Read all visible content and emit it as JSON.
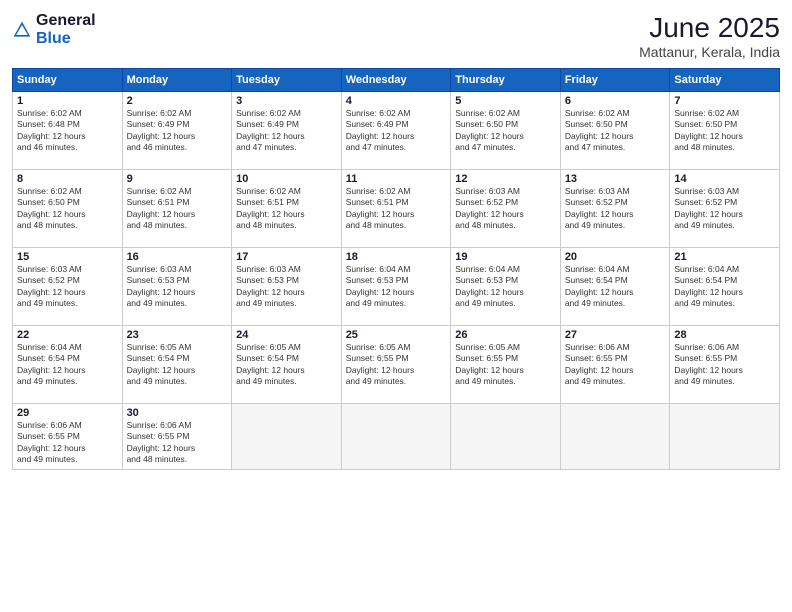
{
  "logo": {
    "general": "General",
    "blue": "Blue"
  },
  "title": "June 2025",
  "location": "Mattanur, Kerala, India",
  "days_header": [
    "Sunday",
    "Monday",
    "Tuesday",
    "Wednesday",
    "Thursday",
    "Friday",
    "Saturday"
  ],
  "weeks": [
    [
      {
        "day": "1",
        "sunrise": "6:02 AM",
        "sunset": "6:48 PM",
        "daylight": "12 hours and 46 minutes."
      },
      {
        "day": "2",
        "sunrise": "6:02 AM",
        "sunset": "6:49 PM",
        "daylight": "12 hours and 46 minutes."
      },
      {
        "day": "3",
        "sunrise": "6:02 AM",
        "sunset": "6:49 PM",
        "daylight": "12 hours and 47 minutes."
      },
      {
        "day": "4",
        "sunrise": "6:02 AM",
        "sunset": "6:49 PM",
        "daylight": "12 hours and 47 minutes."
      },
      {
        "day": "5",
        "sunrise": "6:02 AM",
        "sunset": "6:50 PM",
        "daylight": "12 hours and 47 minutes."
      },
      {
        "day": "6",
        "sunrise": "6:02 AM",
        "sunset": "6:50 PM",
        "daylight": "12 hours and 47 minutes."
      },
      {
        "day": "7",
        "sunrise": "6:02 AM",
        "sunset": "6:50 PM",
        "daylight": "12 hours and 48 minutes."
      }
    ],
    [
      {
        "day": "8",
        "sunrise": "6:02 AM",
        "sunset": "6:50 PM",
        "daylight": "12 hours and 48 minutes."
      },
      {
        "day": "9",
        "sunrise": "6:02 AM",
        "sunset": "6:51 PM",
        "daylight": "12 hours and 48 minutes."
      },
      {
        "day": "10",
        "sunrise": "6:02 AM",
        "sunset": "6:51 PM",
        "daylight": "12 hours and 48 minutes."
      },
      {
        "day": "11",
        "sunrise": "6:02 AM",
        "sunset": "6:51 PM",
        "daylight": "12 hours and 48 minutes."
      },
      {
        "day": "12",
        "sunrise": "6:03 AM",
        "sunset": "6:52 PM",
        "daylight": "12 hours and 48 minutes."
      },
      {
        "day": "13",
        "sunrise": "6:03 AM",
        "sunset": "6:52 PM",
        "daylight": "12 hours and 49 minutes."
      },
      {
        "day": "14",
        "sunrise": "6:03 AM",
        "sunset": "6:52 PM",
        "daylight": "12 hours and 49 minutes."
      }
    ],
    [
      {
        "day": "15",
        "sunrise": "6:03 AM",
        "sunset": "6:52 PM",
        "daylight": "12 hours and 49 minutes."
      },
      {
        "day": "16",
        "sunrise": "6:03 AM",
        "sunset": "6:53 PM",
        "daylight": "12 hours and 49 minutes."
      },
      {
        "day": "17",
        "sunrise": "6:03 AM",
        "sunset": "6:53 PM",
        "daylight": "12 hours and 49 minutes."
      },
      {
        "day": "18",
        "sunrise": "6:04 AM",
        "sunset": "6:53 PM",
        "daylight": "12 hours and 49 minutes."
      },
      {
        "day": "19",
        "sunrise": "6:04 AM",
        "sunset": "6:53 PM",
        "daylight": "12 hours and 49 minutes."
      },
      {
        "day": "20",
        "sunrise": "6:04 AM",
        "sunset": "6:54 PM",
        "daylight": "12 hours and 49 minutes."
      },
      {
        "day": "21",
        "sunrise": "6:04 AM",
        "sunset": "6:54 PM",
        "daylight": "12 hours and 49 minutes."
      }
    ],
    [
      {
        "day": "22",
        "sunrise": "6:04 AM",
        "sunset": "6:54 PM",
        "daylight": "12 hours and 49 minutes."
      },
      {
        "day": "23",
        "sunrise": "6:05 AM",
        "sunset": "6:54 PM",
        "daylight": "12 hours and 49 minutes."
      },
      {
        "day": "24",
        "sunrise": "6:05 AM",
        "sunset": "6:54 PM",
        "daylight": "12 hours and 49 minutes."
      },
      {
        "day": "25",
        "sunrise": "6:05 AM",
        "sunset": "6:55 PM",
        "daylight": "12 hours and 49 minutes."
      },
      {
        "day": "26",
        "sunrise": "6:05 AM",
        "sunset": "6:55 PM",
        "daylight": "12 hours and 49 minutes."
      },
      {
        "day": "27",
        "sunrise": "6:06 AM",
        "sunset": "6:55 PM",
        "daylight": "12 hours and 49 minutes."
      },
      {
        "day": "28",
        "sunrise": "6:06 AM",
        "sunset": "6:55 PM",
        "daylight": "12 hours and 49 minutes."
      }
    ],
    [
      {
        "day": "29",
        "sunrise": "6:06 AM",
        "sunset": "6:55 PM",
        "daylight": "12 hours and 49 minutes."
      },
      {
        "day": "30",
        "sunrise": "6:06 AM",
        "sunset": "6:55 PM",
        "daylight": "12 hours and 48 minutes."
      },
      null,
      null,
      null,
      null,
      null
    ]
  ]
}
